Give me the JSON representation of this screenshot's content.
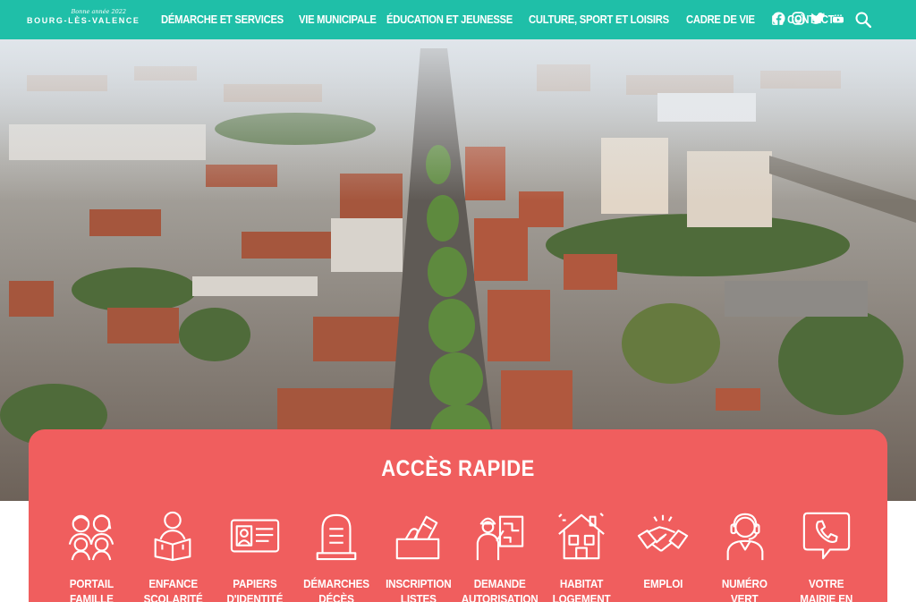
{
  "header": {
    "logo_tagline": "Bonne année 2022",
    "logo_name": "BOURG-LÈS-VALENCE",
    "nav": [
      {
        "label": "Démarche et services"
      },
      {
        "label": "Vie municipale"
      },
      {
        "label": "Éducation et jeunesse"
      },
      {
        "label": "Culture, sport et loisirs"
      },
      {
        "label": "Cadre de vie"
      }
    ],
    "contact_label": "Contact",
    "socials": [
      "facebook-icon",
      "instagram-icon",
      "twitter-icon",
      "youtube-icon"
    ],
    "accent_color": "#1fbfa8"
  },
  "quick_access": {
    "title": "ACCÈS RAPIDE",
    "background_color": "#f05e5e",
    "items": [
      {
        "label": "Portail\nfamille",
        "icon": "family-icon"
      },
      {
        "label": "Enfance\nscolarité",
        "icon": "child-reading-icon"
      },
      {
        "label": "Papiers\nd'identité",
        "icon": "id-card-icon"
      },
      {
        "label": "Démarches\ndécès",
        "icon": "tombstone-icon"
      },
      {
        "label": "Inscription\nlistes",
        "icon": "ballot-box-icon"
      },
      {
        "label": "Demande\nautorisation",
        "icon": "worker-plan-icon"
      },
      {
        "label": "Habitat\nlogement",
        "icon": "house-icon"
      },
      {
        "label": "Emploi",
        "icon": "handshake-icon"
      },
      {
        "label": "Numéro\nvert",
        "icon": "operator-icon"
      },
      {
        "label": "Votre\nmairie en",
        "icon": "phone-bubble-icon"
      }
    ]
  }
}
